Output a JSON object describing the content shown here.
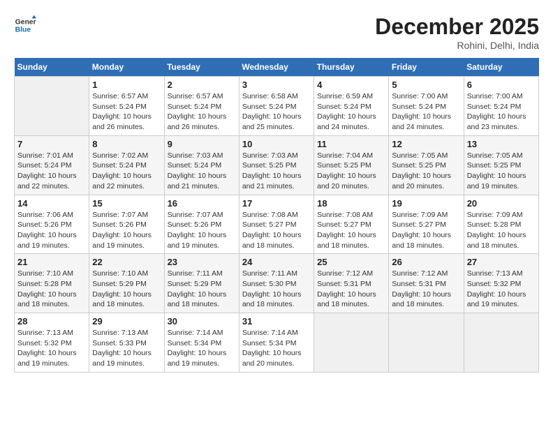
{
  "header": {
    "logo_line1": "General",
    "logo_line2": "Blue",
    "title": "December 2025",
    "subtitle": "Rohini, Delhi, India"
  },
  "days_of_week": [
    "Sunday",
    "Monday",
    "Tuesday",
    "Wednesday",
    "Thursday",
    "Friday",
    "Saturday"
  ],
  "weeks": [
    [
      {
        "day": "",
        "empty": true
      },
      {
        "day": "1",
        "sunrise": "6:57 AM",
        "sunset": "5:24 PM",
        "daylight": "10 hours and 26 minutes."
      },
      {
        "day": "2",
        "sunrise": "6:57 AM",
        "sunset": "5:24 PM",
        "daylight": "10 hours and 26 minutes."
      },
      {
        "day": "3",
        "sunrise": "6:58 AM",
        "sunset": "5:24 PM",
        "daylight": "10 hours and 25 minutes."
      },
      {
        "day": "4",
        "sunrise": "6:59 AM",
        "sunset": "5:24 PM",
        "daylight": "10 hours and 24 minutes."
      },
      {
        "day": "5",
        "sunrise": "7:00 AM",
        "sunset": "5:24 PM",
        "daylight": "10 hours and 24 minutes."
      },
      {
        "day": "6",
        "sunrise": "7:00 AM",
        "sunset": "5:24 PM",
        "daylight": "10 hours and 23 minutes."
      }
    ],
    [
      {
        "day": "7",
        "sunrise": "7:01 AM",
        "sunset": "5:24 PM",
        "daylight": "10 hours and 22 minutes."
      },
      {
        "day": "8",
        "sunrise": "7:02 AM",
        "sunset": "5:24 PM",
        "daylight": "10 hours and 22 minutes."
      },
      {
        "day": "9",
        "sunrise": "7:03 AM",
        "sunset": "5:24 PM",
        "daylight": "10 hours and 21 minutes."
      },
      {
        "day": "10",
        "sunrise": "7:03 AM",
        "sunset": "5:25 PM",
        "daylight": "10 hours and 21 minutes."
      },
      {
        "day": "11",
        "sunrise": "7:04 AM",
        "sunset": "5:25 PM",
        "daylight": "10 hours and 20 minutes."
      },
      {
        "day": "12",
        "sunrise": "7:05 AM",
        "sunset": "5:25 PM",
        "daylight": "10 hours and 20 minutes."
      },
      {
        "day": "13",
        "sunrise": "7:05 AM",
        "sunset": "5:25 PM",
        "daylight": "10 hours and 19 minutes."
      }
    ],
    [
      {
        "day": "14",
        "sunrise": "7:06 AM",
        "sunset": "5:26 PM",
        "daylight": "10 hours and 19 minutes."
      },
      {
        "day": "15",
        "sunrise": "7:07 AM",
        "sunset": "5:26 PM",
        "daylight": "10 hours and 19 minutes."
      },
      {
        "day": "16",
        "sunrise": "7:07 AM",
        "sunset": "5:26 PM",
        "daylight": "10 hours and 19 minutes."
      },
      {
        "day": "17",
        "sunrise": "7:08 AM",
        "sunset": "5:27 PM",
        "daylight": "10 hours and 18 minutes."
      },
      {
        "day": "18",
        "sunrise": "7:08 AM",
        "sunset": "5:27 PM",
        "daylight": "10 hours and 18 minutes."
      },
      {
        "day": "19",
        "sunrise": "7:09 AM",
        "sunset": "5:27 PM",
        "daylight": "10 hours and 18 minutes."
      },
      {
        "day": "20",
        "sunrise": "7:09 AM",
        "sunset": "5:28 PM",
        "daylight": "10 hours and 18 minutes."
      }
    ],
    [
      {
        "day": "21",
        "sunrise": "7:10 AM",
        "sunset": "5:28 PM",
        "daylight": "10 hours and 18 minutes."
      },
      {
        "day": "22",
        "sunrise": "7:10 AM",
        "sunset": "5:29 PM",
        "daylight": "10 hours and 18 minutes."
      },
      {
        "day": "23",
        "sunrise": "7:11 AM",
        "sunset": "5:29 PM",
        "daylight": "10 hours and 18 minutes."
      },
      {
        "day": "24",
        "sunrise": "7:11 AM",
        "sunset": "5:30 PM",
        "daylight": "10 hours and 18 minutes."
      },
      {
        "day": "25",
        "sunrise": "7:12 AM",
        "sunset": "5:31 PM",
        "daylight": "10 hours and 18 minutes."
      },
      {
        "day": "26",
        "sunrise": "7:12 AM",
        "sunset": "5:31 PM",
        "daylight": "10 hours and 18 minutes."
      },
      {
        "day": "27",
        "sunrise": "7:13 AM",
        "sunset": "5:32 PM",
        "daylight": "10 hours and 19 minutes."
      }
    ],
    [
      {
        "day": "28",
        "sunrise": "7:13 AM",
        "sunset": "5:32 PM",
        "daylight": "10 hours and 19 minutes."
      },
      {
        "day": "29",
        "sunrise": "7:13 AM",
        "sunset": "5:33 PM",
        "daylight": "10 hours and 19 minutes."
      },
      {
        "day": "30",
        "sunrise": "7:14 AM",
        "sunset": "5:34 PM",
        "daylight": "10 hours and 19 minutes."
      },
      {
        "day": "31",
        "sunrise": "7:14 AM",
        "sunset": "5:34 PM",
        "daylight": "10 hours and 20 minutes."
      },
      {
        "day": "",
        "empty": true
      },
      {
        "day": "",
        "empty": true
      },
      {
        "day": "",
        "empty": true
      }
    ]
  ],
  "labels": {
    "sunrise_prefix": "Sunrise: ",
    "sunset_prefix": "Sunset: ",
    "daylight_prefix": "Daylight: "
  }
}
